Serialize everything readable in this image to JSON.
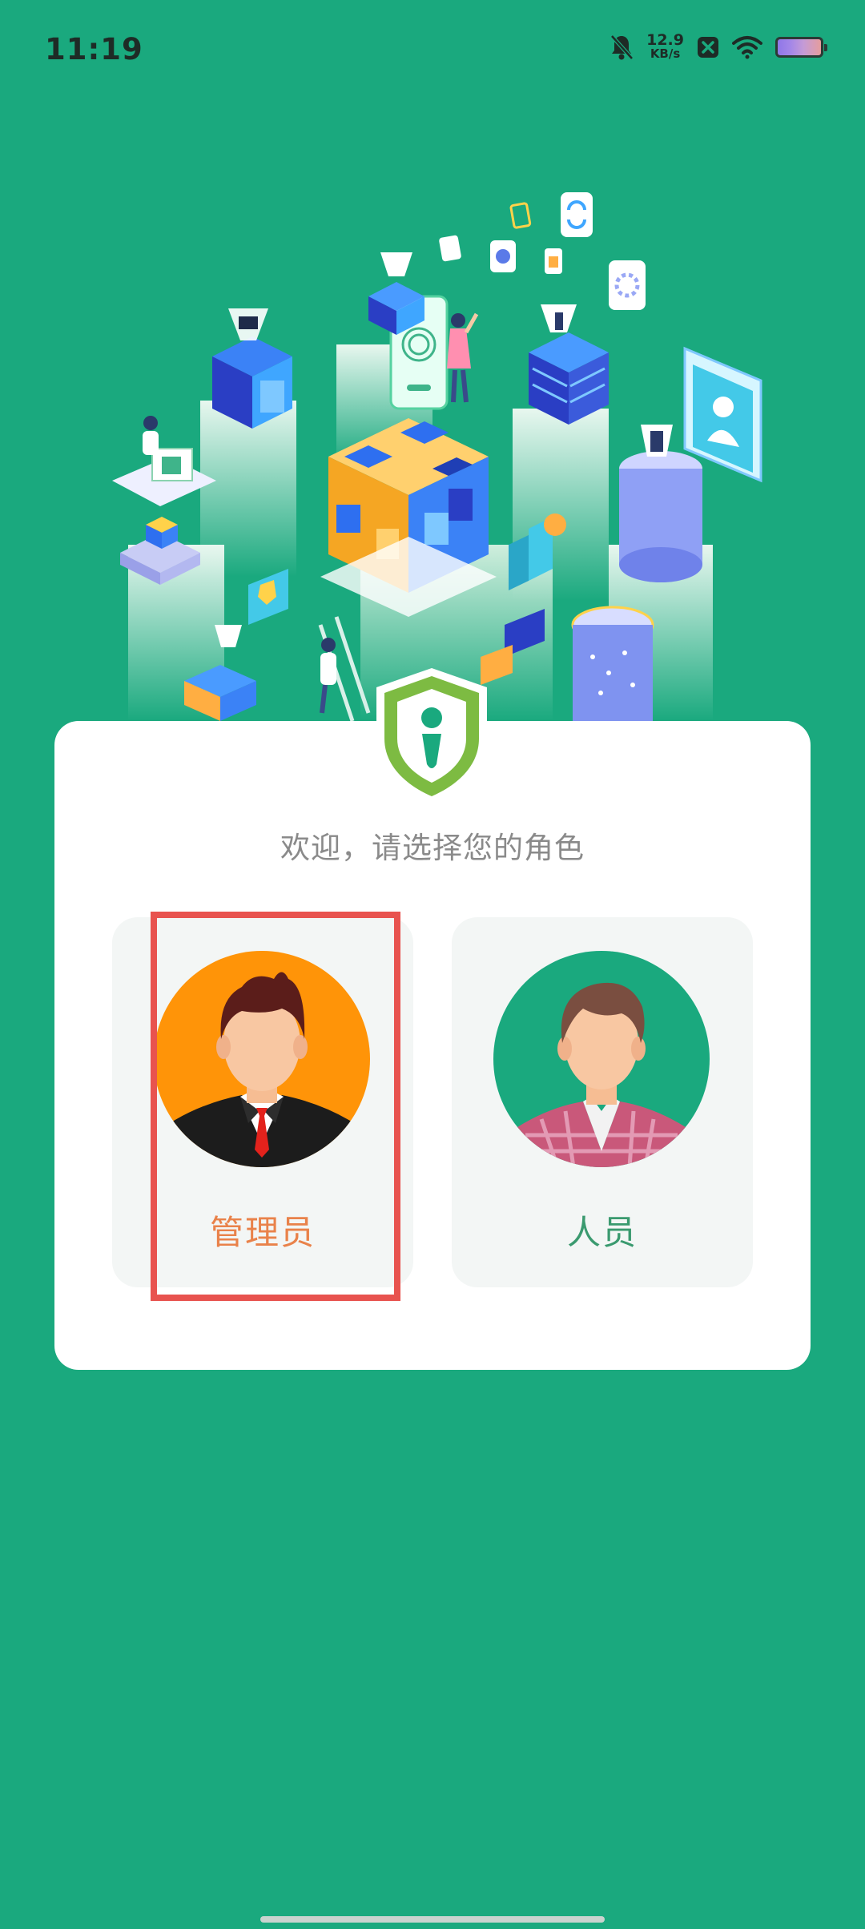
{
  "status_bar": {
    "time": "11:19",
    "net_speed_value": "12.9",
    "net_speed_unit": "KB/s",
    "icons": [
      "bell-off-icon",
      "app-notification-icon",
      "wifi-icon",
      "battery-icon"
    ]
  },
  "welcome_text": "欢迎，请选择您的角色",
  "roles": [
    {
      "label": "管理员",
      "avatar": "admin-avatar",
      "avatar_bg": "#ff9408",
      "label_color": "#e9824a",
      "highlighted": true
    },
    {
      "label": "人员",
      "avatar": "staff-avatar",
      "avatar_bg": "#1aa97e",
      "label_color": "#3a9a6f",
      "highlighted": false
    }
  ],
  "colors": {
    "background": "#1aa97e",
    "card": "#ffffff",
    "highlight": "#e8534f",
    "shield": "#7dbb42"
  }
}
